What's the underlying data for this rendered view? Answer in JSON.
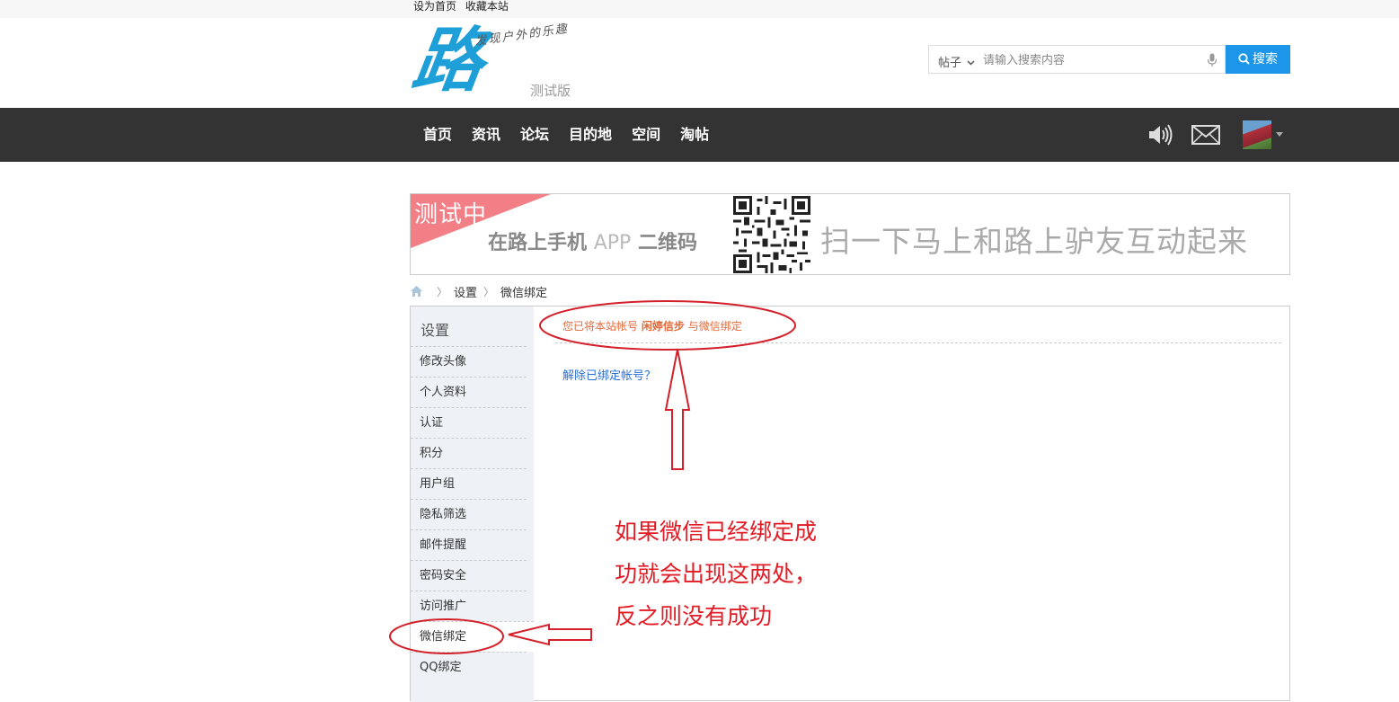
{
  "top_links": [
    "设为首页",
    "收藏本站"
  ],
  "logo": {
    "slogan": "发现户外的乐趣",
    "beta": "测试版"
  },
  "search": {
    "type": "帖子",
    "placeholder": "请输入搜索内容",
    "button": "搜索"
  },
  "nav": {
    "items": [
      "首页",
      "资讯",
      "论坛",
      "目的地",
      "空间",
      "淘帖"
    ]
  },
  "banner": {
    "testing": "测试中",
    "app_text_1": "在路上手机",
    "app_text_2": "APP",
    "app_text_3": "二维码",
    "slogan": "扫一下马上和路上驴友互动起来"
  },
  "breadcrumb": [
    "设置",
    "微信绑定"
  ],
  "sidebar": {
    "title": "设置",
    "items": [
      "修改头像",
      "个人资料",
      "认证",
      "积分",
      "用户组",
      "隐私筛选",
      "邮件提醒",
      "密码安全",
      "访问推广",
      "微信绑定",
      "QQ绑定"
    ],
    "active_index": 9
  },
  "main": {
    "bind_prefix": "您已将本站帐号",
    "username": "闲婷信步",
    "bind_suffix": "与微信绑定",
    "unbind_link": "解除已绑定帐号？"
  },
  "annotation": {
    "lines": [
      "如果微信已经绑定成",
      "功就会出现这两处，",
      "反之则没有成功"
    ],
    "color": "#e31b24"
  }
}
